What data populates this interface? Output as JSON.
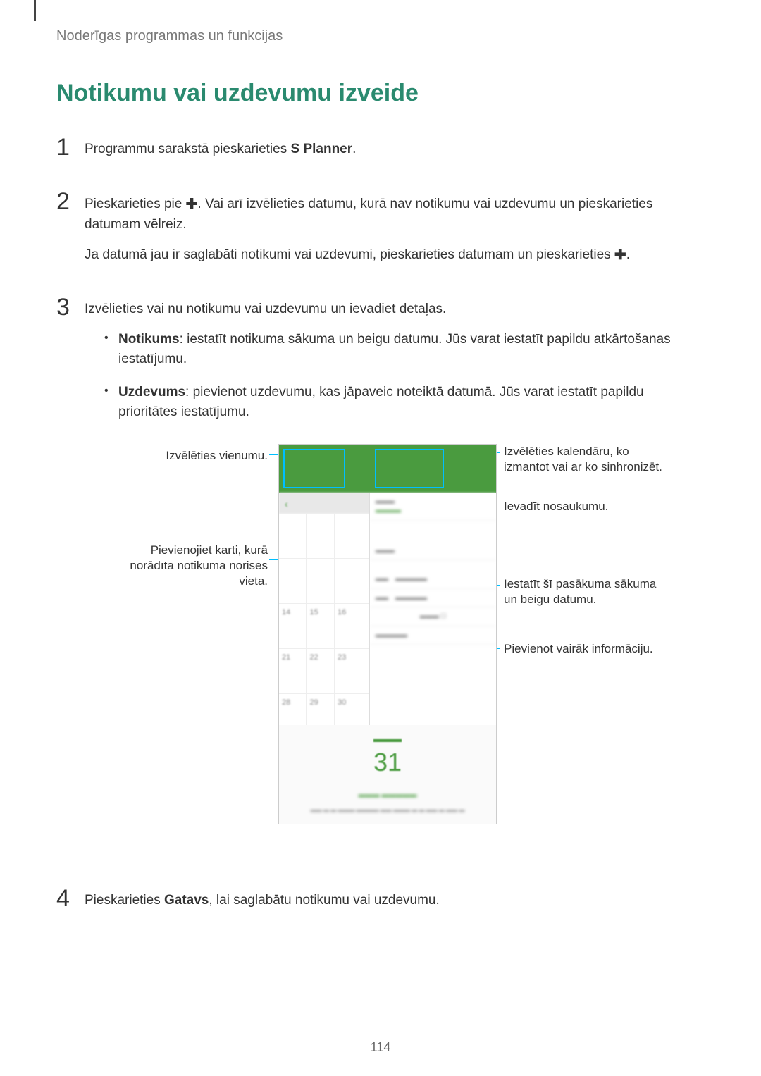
{
  "breadcrumb": "Noderīgas programmas un funkcijas",
  "title": "Notikumu vai uzdevumu izveide",
  "steps": {
    "1": {
      "num": "1",
      "text_pre": "Programmu sarakstā pieskarieties ",
      "bold": "S Planner",
      "suffix": "."
    },
    "2": {
      "num": "2",
      "line1_pre": "Pieskarieties pie ",
      "line1_post": ". Vai arī izvēlieties datumu, kurā nav notikumu vai uzdevumu un pieskarieties datumam vēlreiz.",
      "line2_pre": "Ja datumā jau ir saglabāti notikumi vai uzdevumi, pieskarieties datumam un pieskarieties ",
      "line2_post": "."
    },
    "3": {
      "num": "3",
      "intro": "Izvēlieties vai nu notikumu vai uzdevumu un ievadiet detaļas.",
      "bullet1_bold": "Notikums",
      "bullet1_text": ": iestatīt notikuma sākuma un beigu datumu. Jūs varat iestatīt papildu atkārtošanas iestatījumu.",
      "bullet2_bold": "Uzdevums",
      "bullet2_text": ": pievienot uzdevumu, kas jāpaveic noteiktā datumā. Jūs varat iestatīt papildu prioritātes iestatījumu."
    },
    "4": {
      "num": "4",
      "text_pre": "Pieskarieties ",
      "bold": "Gatavs",
      "suffix": ", lai saglabātu notikumu vai uzdevumu."
    }
  },
  "labels": {
    "left1": "Izvēlēties vienumu.",
    "left2": "Pievienojiet karti, kurā norādīta notikuma norises vieta.",
    "right1": "Izvēlēties kalendāru, ko izmantot vai ar ko sinhronizēt.",
    "right2": "Ievadīt nosaukumu.",
    "right3": "Iestatīt šī pasākuma sākuma un beigu datumu.",
    "right4": "Pievienot vairāk informāciju."
  },
  "screenshot": {
    "big_date": "31",
    "dates_row3": [
      "14",
      "15",
      "16"
    ],
    "dates_row4": [
      "21",
      "22",
      "23"
    ],
    "dates_row5": [
      "28",
      "29",
      "30"
    ]
  },
  "page_number": "114"
}
